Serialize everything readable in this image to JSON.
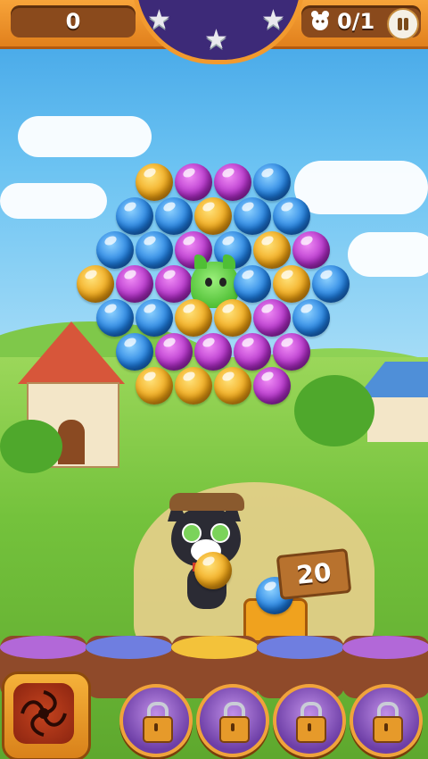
{
  "hud": {
    "score": "0",
    "goal": "0/1",
    "star_count": 3
  },
  "playfield": {
    "bubble_rows": [
      [
        "yellow",
        "purple",
        "purple",
        "blue"
      ],
      [
        "blue",
        "blue",
        "yellow",
        "blue",
        "blue"
      ],
      [
        "blue",
        "blue",
        "purple",
        "blue",
        "yellow",
        "purple"
      ],
      [
        "yellow",
        "purple",
        "purple",
        "pet",
        "blue",
        "yellow",
        "blue"
      ],
      [
        "blue",
        "blue",
        "yellow",
        "yellow",
        "purple",
        "blue"
      ],
      [
        "blue",
        "purple",
        "purple",
        "purple",
        "purple"
      ],
      [
        "yellow",
        "yellow",
        "yellow",
        "purple"
      ]
    ]
  },
  "shooter": {
    "current_bubble": "yellow",
    "next_bubble": "blue",
    "moves_left": "20"
  },
  "boosters": {
    "main_icon": "swirl-icon",
    "slots": [
      {
        "icon": "lock-icon",
        "locked": true
      },
      {
        "icon": "lock-icon",
        "locked": true
      },
      {
        "icon": "lock-icon",
        "locked": true
      },
      {
        "icon": "lock-icon",
        "locked": true
      }
    ]
  },
  "colors": {
    "yellow": "#f0a414",
    "purple": "#b12ec8",
    "blue": "#1e7de0",
    "hud_orange": "#e1801c"
  }
}
